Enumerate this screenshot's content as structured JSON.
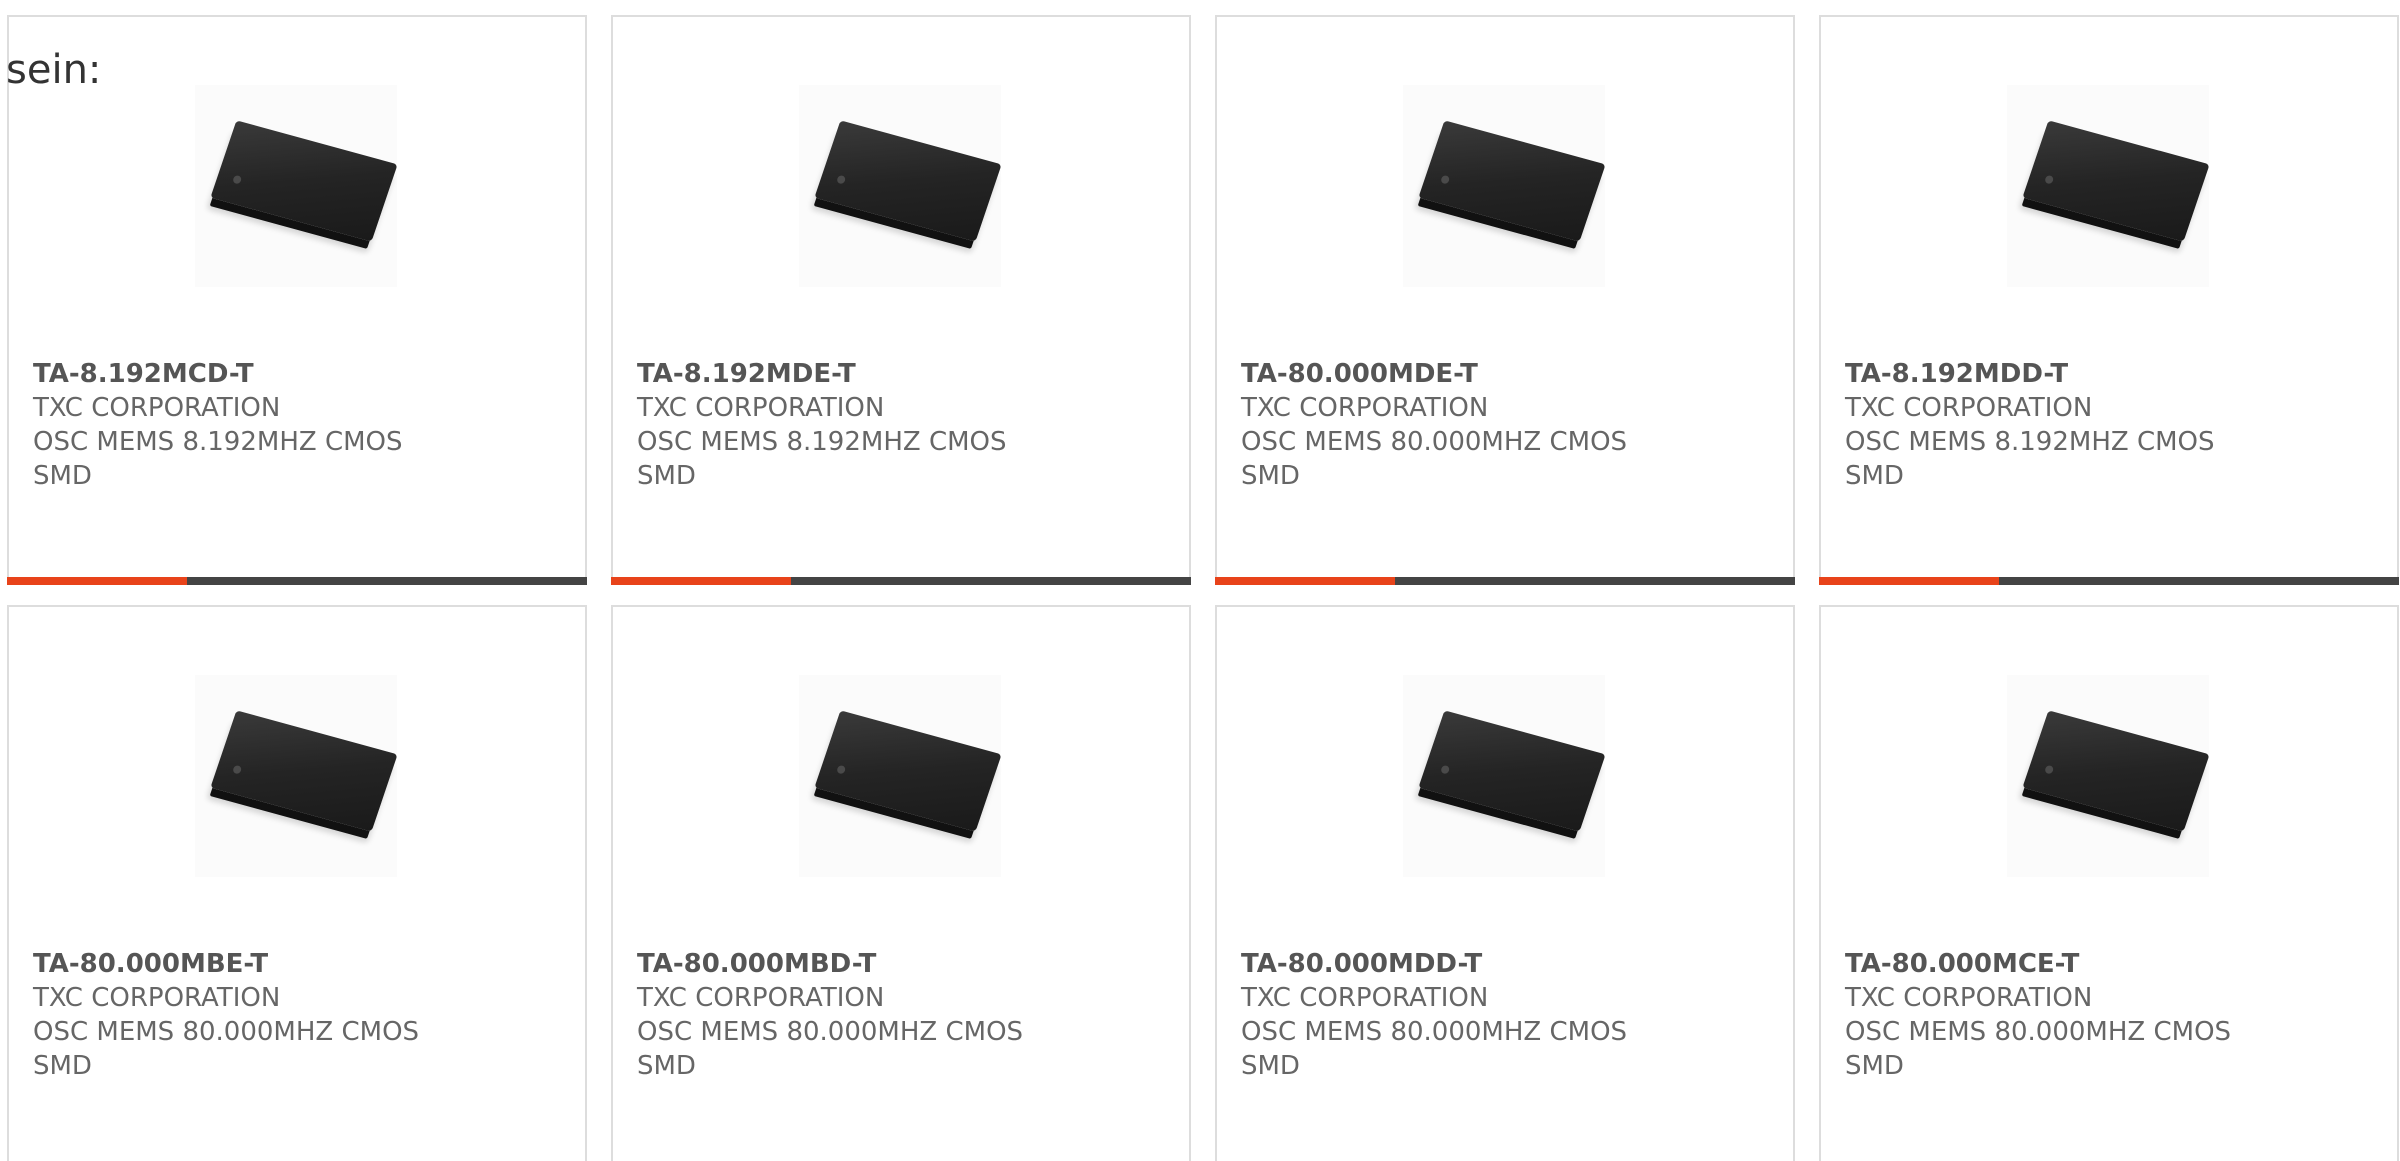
{
  "intro_text": "sein:",
  "accent_color": "#e8431a",
  "products": [
    {
      "part": "TA-8.192MCD-T",
      "manufacturer": "TXC CORPORATION",
      "description": "OSC MEMS 8.192MHZ CMOS SMD",
      "image_icon": "smd-chip-image",
      "progress": 0.31
    },
    {
      "part": "TA-8.192MDE-T",
      "manufacturer": "TXC CORPORATION",
      "description": "OSC MEMS 8.192MHZ CMOS SMD",
      "image_icon": "smd-chip-image",
      "progress": 0.31
    },
    {
      "part": "TA-80.000MDE-T",
      "manufacturer": "TXC CORPORATION",
      "description": "OSC MEMS 80.000MHZ CMOS SMD",
      "image_icon": "smd-chip-image",
      "progress": 0.31
    },
    {
      "part": "TA-8.192MDD-T",
      "manufacturer": "TXC CORPORATION",
      "description": "OSC MEMS 8.192MHZ CMOS SMD",
      "image_icon": "smd-chip-image",
      "progress": 0.31
    },
    {
      "part": "TA-80.000MBE-T",
      "manufacturer": "TXC CORPORATION",
      "description": "OSC MEMS 80.000MHZ CMOS SMD",
      "image_icon": "smd-chip-image"
    },
    {
      "part": "TA-80.000MBD-T",
      "manufacturer": "TXC CORPORATION",
      "description": "OSC MEMS 80.000MHZ CMOS SMD",
      "image_icon": "smd-chip-image"
    },
    {
      "part": "TA-80.000MDD-T",
      "manufacturer": "TXC CORPORATION",
      "description": "OSC MEMS 80.000MHZ CMOS SMD",
      "image_icon": "smd-chip-image"
    },
    {
      "part": "TA-80.000MCE-T",
      "manufacturer": "TXC CORPORATION",
      "description": "OSC MEMS 80.000MHZ CMOS SMD",
      "image_icon": "smd-chip-image"
    }
  ]
}
